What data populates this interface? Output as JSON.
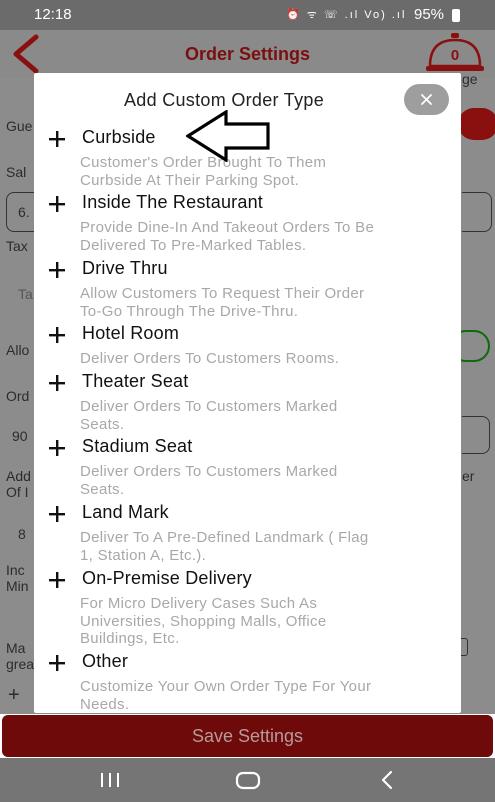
{
  "status_bar": {
    "time": "12:18",
    "indicators": "⏰ ᯤ ☏ .ıl Vo) .ıl",
    "battery": "95%"
  },
  "header": {
    "title": "Order Settings",
    "badge_count": "0"
  },
  "background_form": {
    "labels": [
      "Gue",
      "Sal",
      "6.",
      "Tax",
      "Ta",
      "Allo",
      "Ord",
      "90",
      "Add",
      "Of I",
      "8",
      "Inc",
      "Min",
      "Ma",
      "grea",
      "+"
    ],
    "right_fragments": [
      "ge",
      "er"
    ]
  },
  "modal": {
    "title": "Add Custom Order Type",
    "close_label": "×",
    "items": [
      {
        "title": "Curbside",
        "description": "Customer's Order Brought To Them\nCurbside At Their Parking Spot."
      },
      {
        "title": "Inside The Restaurant",
        "description": "Provide Dine-In And Takeout Orders To Be\nDelivered To Pre-Marked Tables."
      },
      {
        "title": "Drive Thru",
        "description": "Allow Customers To Request Their Order\nTo-Go Through The Drive-Thru."
      },
      {
        "title": "Hotel Room",
        "description": "Deliver Orders To Customers Rooms."
      },
      {
        "title": "Theater Seat",
        "description": "Deliver Orders To Customers Marked\nSeats."
      },
      {
        "title": "Stadium Seat",
        "description": "Deliver Orders To Customers Marked\nSeats."
      },
      {
        "title": "Land Mark",
        "description": "Deliver To A Pre-Defined Landmark ( Flag\n1, Station A, Etc.)."
      },
      {
        "title": "On-Premise Delivery",
        "description": "For Micro Delivery Cases Such As\nUniversities, Shopping Malls, Office\nBuildings, Etc."
      },
      {
        "title": "Other",
        "description": "Customize Your Own Order Type For Your\nNeeds."
      }
    ]
  },
  "footer": {
    "save_label": "Save Settings"
  },
  "colors": {
    "brand_red": "#b50f0f",
    "overlay_dim": "#8c8c8c",
    "description_gray": "#a8a8a8"
  },
  "icons": {
    "back": "chevron-left-icon",
    "bell": "service-bell-icon",
    "add": "plus-icon",
    "close": "close-icon",
    "pointer": "arrow-left-outline-icon",
    "nav_recents": "recents-icon",
    "nav_home": "home-icon",
    "nav_back": "back-icon"
  }
}
